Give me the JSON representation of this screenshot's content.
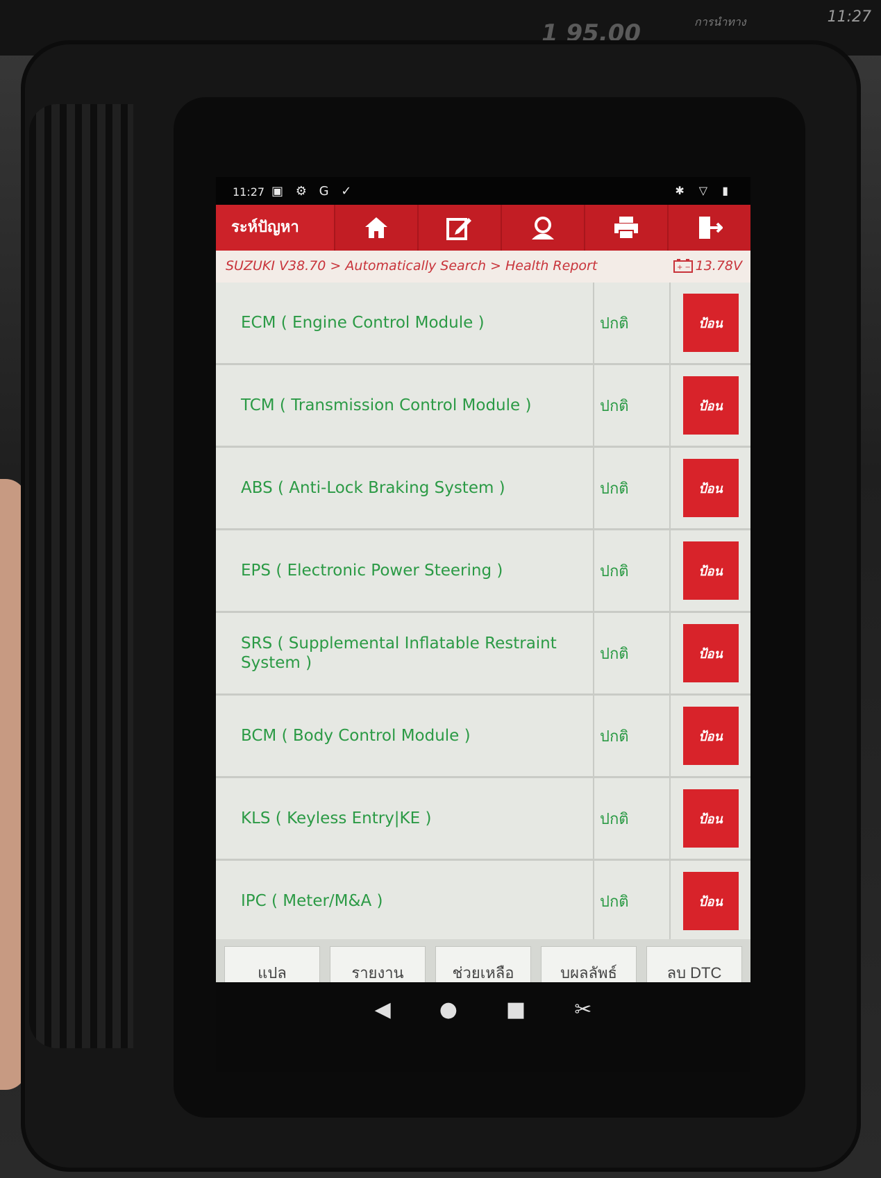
{
  "car_display": {
    "time": "11:27",
    "nav_label": "การนำทาง",
    "speed": "1 95.00"
  },
  "statusbar": {
    "time": "11:27",
    "icons": "▣ ⚙ G ✓",
    "right_icons": "✱ ▽ ▮"
  },
  "topbar": {
    "title": "ระห์ปัญหา",
    "buttons": [
      {
        "icon": "home-icon"
      },
      {
        "icon": "edit-icon"
      },
      {
        "icon": "support-icon"
      },
      {
        "icon": "print-icon"
      },
      {
        "icon": "exit-icon"
      }
    ]
  },
  "breadcrumb": {
    "path": "SUZUKI V38.70 > Automatically Search > Health Report",
    "voltage": "13.78V"
  },
  "modules": [
    {
      "name": "ECM ( Engine Control Module )",
      "status": "ปกติ",
      "action": "ป้อน"
    },
    {
      "name": "TCM ( Transmission Control Module )",
      "status": "ปกติ",
      "action": "ป้อน"
    },
    {
      "name": "ABS ( Anti-Lock Braking System )",
      "status": "ปกติ",
      "action": "ป้อน"
    },
    {
      "name": "EPS ( Electronic Power Steering )",
      "status": "ปกติ",
      "action": "ป้อน"
    },
    {
      "name": "SRS ( Supplemental Inflatable Restraint System )",
      "status": "ปกติ",
      "action": "ป้อน"
    },
    {
      "name": "BCM ( Body Control Module )",
      "status": "ปกติ",
      "action": "ป้อน"
    },
    {
      "name": "KLS ( Keyless Entry|KE )",
      "status": "ปกติ",
      "action": "ป้อน"
    },
    {
      "name": "IPC ( Meter/M&A )",
      "status": "ปกติ",
      "action": "ป้อน"
    }
  ],
  "bottom_buttons": [
    "แปล",
    "รายงาน",
    "ช่วยเหลือ",
    "บผลลัพธ์",
    "ลบ DTC"
  ],
  "navbar": {
    "back": "◀",
    "home": "●",
    "recents": "■",
    "screenshot": "✂"
  },
  "colors": {
    "accent_red": "#cc2229",
    "status_green": "#2b9a45"
  }
}
